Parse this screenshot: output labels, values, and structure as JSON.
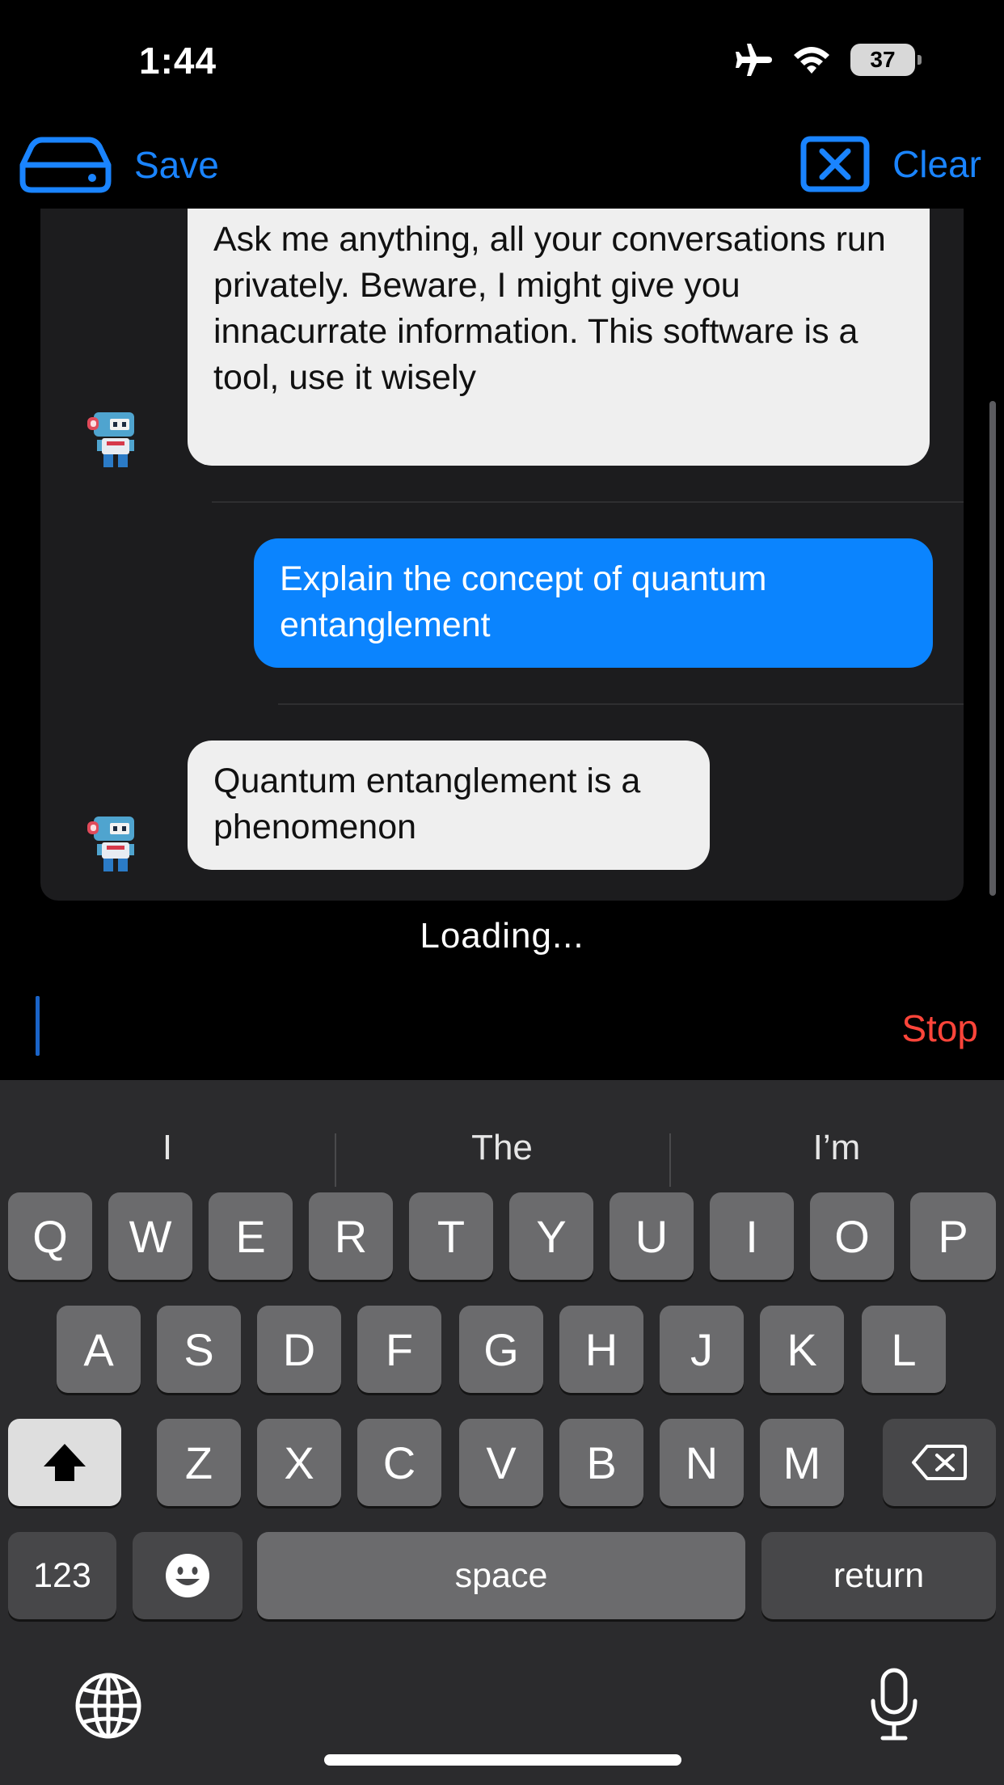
{
  "status_bar": {
    "time": "1:44",
    "battery": "37",
    "icons": [
      "airplane-icon",
      "wifi-icon",
      "battery-icon"
    ]
  },
  "nav": {
    "save_label": "Save",
    "clear_label": "Clear"
  },
  "messages": [
    {
      "role": "assistant",
      "text": "Ask me anything, all your conversations run privately. Beware, I might give you innacurrate information. This software is a tool, use it wisely"
    },
    {
      "role": "user",
      "text": "Explain the concept of quantum entanglement"
    },
    {
      "role": "assistant",
      "text": "Quantum entanglement is a phenomenon"
    }
  ],
  "loading_text": "Loading...",
  "input": {
    "value": "",
    "stop_label": "Stop"
  },
  "keyboard": {
    "suggestions": [
      "I",
      "The",
      "I’m"
    ],
    "row1": [
      "Q",
      "W",
      "E",
      "R",
      "T",
      "Y",
      "U",
      "I",
      "O",
      "P"
    ],
    "row2": [
      "A",
      "S",
      "D",
      "F",
      "G",
      "H",
      "J",
      "K",
      "L"
    ],
    "row3": [
      "Z",
      "X",
      "C",
      "V",
      "B",
      "N",
      "M"
    ],
    "numbers_label": "123",
    "space_label": "space",
    "return_label": "return"
  },
  "colors": {
    "accent": "#1a84ff",
    "user_bubble": "#0b84fe",
    "bot_bubble": "#efefef",
    "stop": "#ff453a",
    "panel": "#1c1c1e"
  }
}
